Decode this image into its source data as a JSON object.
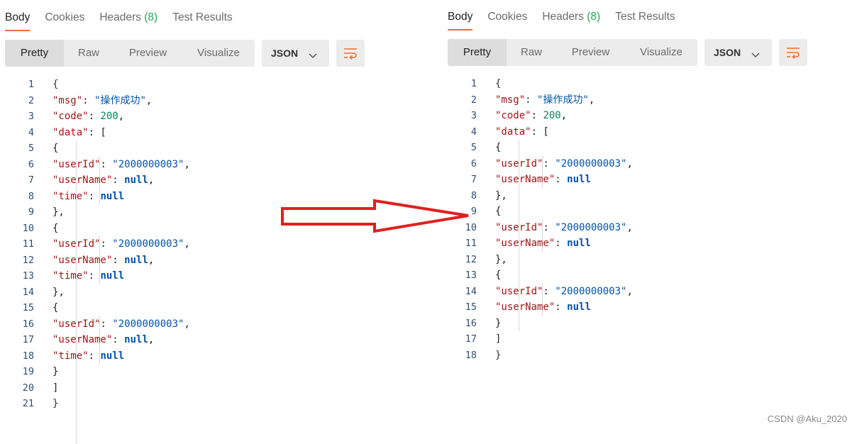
{
  "tabs": {
    "body": "Body",
    "cookies": "Cookies",
    "headers": "Headers",
    "headers_count": "(8)",
    "test_results": "Test Results"
  },
  "view_modes": [
    "Pretty",
    "Raw",
    "Preview",
    "Visualize"
  ],
  "format": "JSON",
  "icons": {
    "dropdown": "chevron-down-icon",
    "wrap": "wrap-lines-icon",
    "arrow": "right-arrow-icon"
  },
  "colors": {
    "accent": "#f26b3a",
    "count": "#26a65b",
    "arrow": "#e02020",
    "json_key": "#a31515",
    "json_string": "#0451a5",
    "json_number": "#098658"
  },
  "left_response": {
    "msg_value": "\"操作成功\"",
    "code_value": "200",
    "items": [
      {
        "userId": "\"2000000003\"",
        "userName": "null",
        "time": "null"
      },
      {
        "userId": "\"2000000003\"",
        "userName": "null",
        "time": "null"
      },
      {
        "userId": "\"2000000003\"",
        "userName": "null",
        "time": "null"
      }
    ]
  },
  "right_response": {
    "msg_value": "\"操作成功\"",
    "code_value": "200",
    "items": [
      {
        "userId": "\"2000000003\"",
        "userName": "null"
      },
      {
        "userId": "\"2000000003\"",
        "userName": "null"
      },
      {
        "userId": "\"2000000003\"",
        "userName": "null"
      }
    ]
  },
  "watermark": "CSDN @Aku_2020"
}
